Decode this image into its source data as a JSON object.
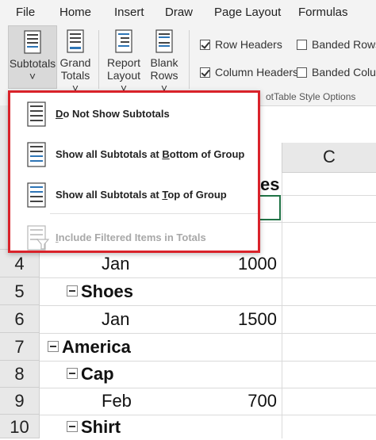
{
  "menubar": {
    "tabs": [
      "File",
      "Home",
      "Insert",
      "Draw",
      "Page Layout",
      "Formulas"
    ]
  },
  "ribbon": {
    "subtotals": {
      "line1": "Subtotals",
      "line2": "˅"
    },
    "grand_totals": {
      "line1": "Grand",
      "line2": "Totals ˅"
    },
    "report_layout": {
      "line1": "Report",
      "line2": "Layout ˅"
    },
    "blank_rows": {
      "line1": "Blank",
      "line2": "Rows ˅"
    },
    "row_headers": {
      "label": "Row Headers",
      "checked": true
    },
    "column_headers": {
      "label": "Column Headers",
      "checked": true
    },
    "banded_rows": {
      "label": "Banded Rows",
      "checked": false
    },
    "banded_columns": {
      "label": "Banded Colum",
      "checked": false
    },
    "group_label": "otTable Style Options"
  },
  "dropdown": {
    "items": [
      {
        "pre": "",
        "key": "D",
        "post": "o Not Show Subtotals",
        "enabled": true
      },
      {
        "pre": "Show all Subtotals at ",
        "key": "B",
        "post": "ottom of Group",
        "enabled": true
      },
      {
        "pre": "Show all Subtotals at ",
        "key": "T",
        "post": "op of Group",
        "enabled": true
      },
      {
        "pre": "",
        "key": "I",
        "post": "nclude Filtered Items in Totals",
        "enabled": false
      }
    ],
    "border_color": "#d9222a"
  },
  "sheet": {
    "column_header_c": "C",
    "header_fragment": "es",
    "rows": [
      {
        "num": "4",
        "label": "Jan",
        "value": "1000",
        "bold": false,
        "expander": false
      },
      {
        "num": "5",
        "label": "Shoes",
        "value": "",
        "bold": true,
        "expander": true
      },
      {
        "num": "6",
        "label": "Jan",
        "value": "1500",
        "bold": false,
        "expander": false
      },
      {
        "num": "7",
        "label": "America",
        "value": "",
        "bold": true,
        "expander": true
      },
      {
        "num": "8",
        "label": "Cap",
        "value": "",
        "bold": true,
        "expander": true
      },
      {
        "num": "9",
        "label": "Feb",
        "value": "700",
        "bold": false,
        "expander": false
      },
      {
        "num": "10",
        "label": "Shirt",
        "value": "",
        "bold": true,
        "expander": true
      }
    ]
  }
}
